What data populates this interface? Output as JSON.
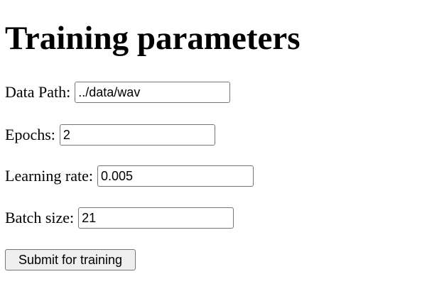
{
  "page": {
    "title": "Training parameters"
  },
  "form": {
    "data_path": {
      "label": "Data Path:",
      "value": "../data/wav"
    },
    "epochs": {
      "label": "Epochs:",
      "value": "2"
    },
    "learning_rate": {
      "label": "Learning rate:",
      "value": "0.005"
    },
    "batch_size": {
      "label": "Batch size:",
      "value": "21"
    },
    "submit_label": "Submit for training"
  }
}
